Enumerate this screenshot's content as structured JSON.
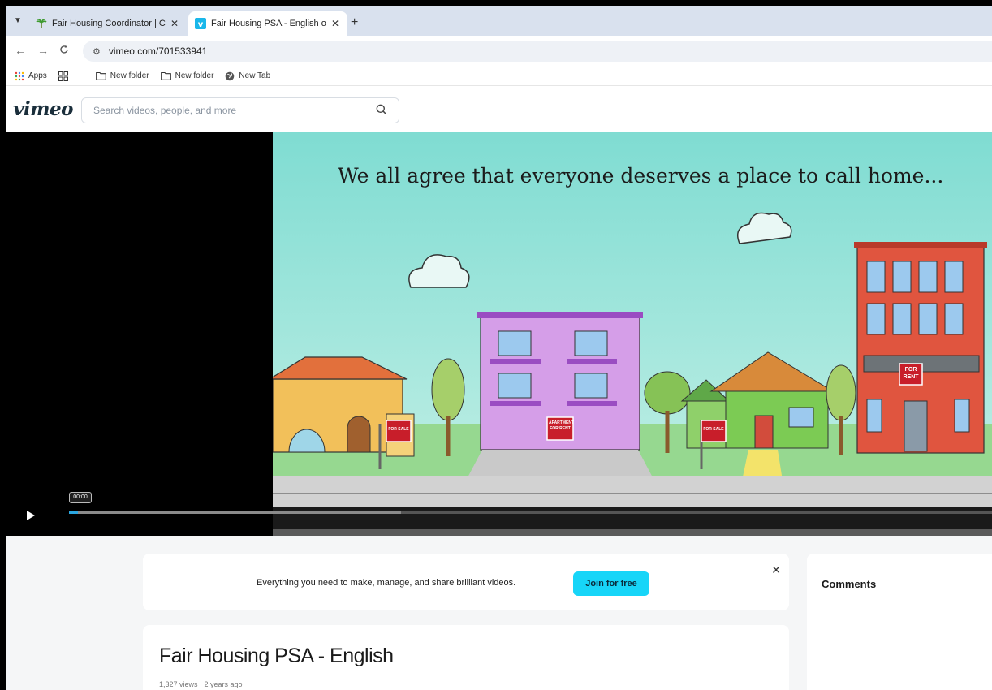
{
  "browser": {
    "tabs": [
      {
        "title": "Fair Housing Coordinator | City",
        "active": false
      },
      {
        "title": "Fair Housing PSA - English on V",
        "active": true
      }
    ],
    "tab_dropdown_icon": "chevron-down-icon",
    "new_tab_label": "+",
    "url": "vimeo.com/701533941",
    "bookmarks": [
      {
        "label": "Apps",
        "icon": "apps-grid-icon"
      },
      {
        "label": "",
        "icon": "tab-groups-icon"
      },
      {
        "label": "New folder",
        "icon": "folder-icon"
      },
      {
        "label": "New folder",
        "icon": "folder-icon"
      },
      {
        "label": "New Tab",
        "icon": "globe-icon"
      }
    ]
  },
  "site": {
    "logo": "vimeo",
    "search_placeholder": "Search videos, people, and more"
  },
  "player": {
    "caption": "We all agree that everyone deserves a place to call home...",
    "scene_signs": [
      "FOR SALE",
      "APARTMENT FOR RENT",
      "FOR SALE",
      "FOR RENT"
    ],
    "current_time": "00:00",
    "progress": 0.01,
    "loaded": 0.36,
    "accent_color": "#2aa6e0"
  },
  "promo": {
    "text": "Everything you need to make, manage, and share brilliant videos.",
    "join_label": "Join for free",
    "join_color": "#17d5f8"
  },
  "video": {
    "title": "Fair Housing PSA - English",
    "meta": "1,327 views · 2 years ago"
  },
  "comments": {
    "title": "Comments"
  }
}
